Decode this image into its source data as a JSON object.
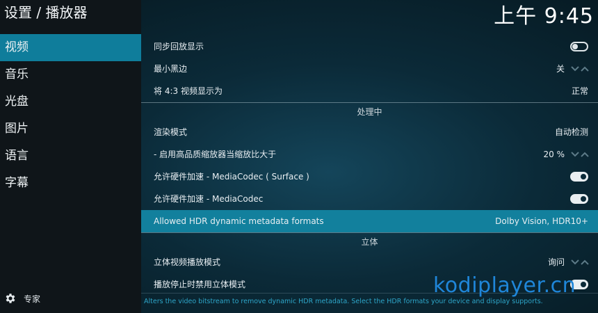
{
  "header": {
    "title": "设置 / 播放器",
    "clock": "上午 9:45"
  },
  "sidebar": {
    "items": [
      {
        "label": "视频"
      },
      {
        "label": "音乐"
      },
      {
        "label": "光盘"
      },
      {
        "label": "图片"
      },
      {
        "label": "语言"
      },
      {
        "label": "字幕"
      }
    ],
    "active_index": 0,
    "expert_label": "专家"
  },
  "settings": {
    "sync_playback": {
      "label": "同步回放显示",
      "state": "off"
    },
    "min_black_bars": {
      "label": "最小黑边",
      "value": "关"
    },
    "display_43": {
      "label": "将 4:3 视频显示为",
      "value": "正常"
    },
    "section_processing": "处理中",
    "render_method": {
      "label": "渲染模式",
      "value": "自动检测"
    },
    "hq_scaler": {
      "label": "- 启用高品质缩放器当缩放比大于",
      "value": "20 %"
    },
    "hw_surface": {
      "label": "允许硬件加速 - MediaCodec ( Surface )",
      "state": "on"
    },
    "hw_mediacodec": {
      "label": "允许硬件加速 - MediaCodec",
      "state": "on"
    },
    "hdr_formats": {
      "label": "Allowed HDR dynamic metadata formats",
      "value": "Dolby Vision, HDR10+"
    },
    "section_stereo": "立体",
    "stereo_mode": {
      "label": "立体视频播放模式",
      "value": "询问"
    },
    "disable_stereo_on_stop": {
      "label": "播放停止时禁用立体模式",
      "state": "on"
    }
  },
  "hint": "Alters the video bitstream to remove dynamic HDR metadata. Select the HDR formats your device and display supports.",
  "watermark": "kodiplayer.cn",
  "colors": {
    "accent": "#0f7d9b",
    "selected_row": "#12809d",
    "hint_text": "#2ea6c9",
    "watermark": "#1f86d9"
  }
}
